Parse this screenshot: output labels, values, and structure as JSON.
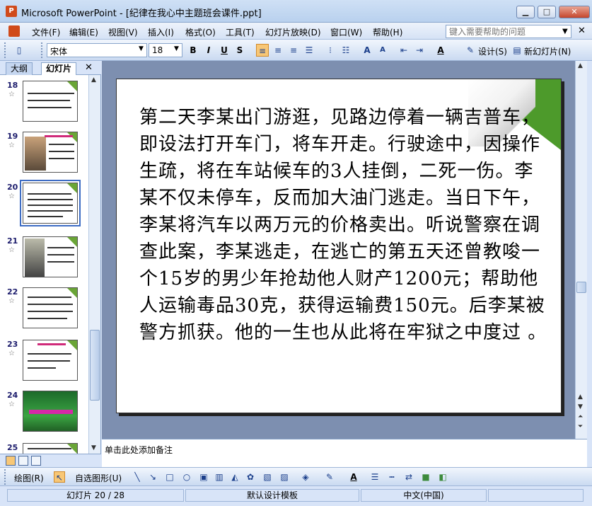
{
  "window": {
    "title": "Microsoft PowerPoint - [纪律在我心中主题班会课件.ppt]",
    "minimize": "▁",
    "maximize": "□",
    "close": "✕"
  },
  "menu": {
    "items": [
      "文件(F)",
      "编辑(E)",
      "视图(V)",
      "插入(I)",
      "格式(O)",
      "工具(T)",
      "幻灯片放映(D)",
      "窗口(W)",
      "帮助(H)"
    ],
    "help_placeholder": "键入需要帮助的问题",
    "close_glyph": "✕"
  },
  "toolbar": {
    "font_name": "宋体",
    "font_size": "18",
    "bold": "B",
    "italic": "I",
    "underline": "U",
    "shadow": "S",
    "design_label": "设计(S)",
    "new_slide_label": "新幻灯片(N)"
  },
  "left_pane": {
    "tabs": [
      "大纲",
      "幻灯片"
    ],
    "close_glyph": "✕",
    "slides": [
      {
        "num": "18",
        "kind": "text"
      },
      {
        "num": "19",
        "kind": "photo"
      },
      {
        "num": "20",
        "kind": "text",
        "selected": true
      },
      {
        "num": "21",
        "kind": "photo2"
      },
      {
        "num": "22",
        "kind": "text"
      },
      {
        "num": "23",
        "kind": "title-text"
      },
      {
        "num": "24",
        "kind": "flower"
      },
      {
        "num": "25",
        "kind": "text"
      }
    ]
  },
  "slide": {
    "body": "第二天李某出门游逛，见路边停着一辆吉普车，即设法打开车门，将车开走。行驶途中，因操作生疏，将在车站候车的3人挂倒，二死一伤。李某不仅未停车，反而加大油门逃走。当日下午，李某将汽车以两万元的价格卖出。听说警察在调查此案，李某逃走，在逃亡的第五天还曾教唆一个15岁的男少年抢劫他人财产1200元；帮助他人运输毒品30克，获得运输费150元。后李某被警方抓获。他的一生也从此将在牢狱之中度过 。"
  },
  "notes": {
    "placeholder": "单击此处添加备注"
  },
  "drawbar": {
    "draw_label": "绘图(R)",
    "autoshapes_label": "自选图形(U)"
  },
  "status": {
    "slide_info": "幻灯片 20 / 28",
    "template": "默认设计模板",
    "language": "中文(中国)"
  }
}
